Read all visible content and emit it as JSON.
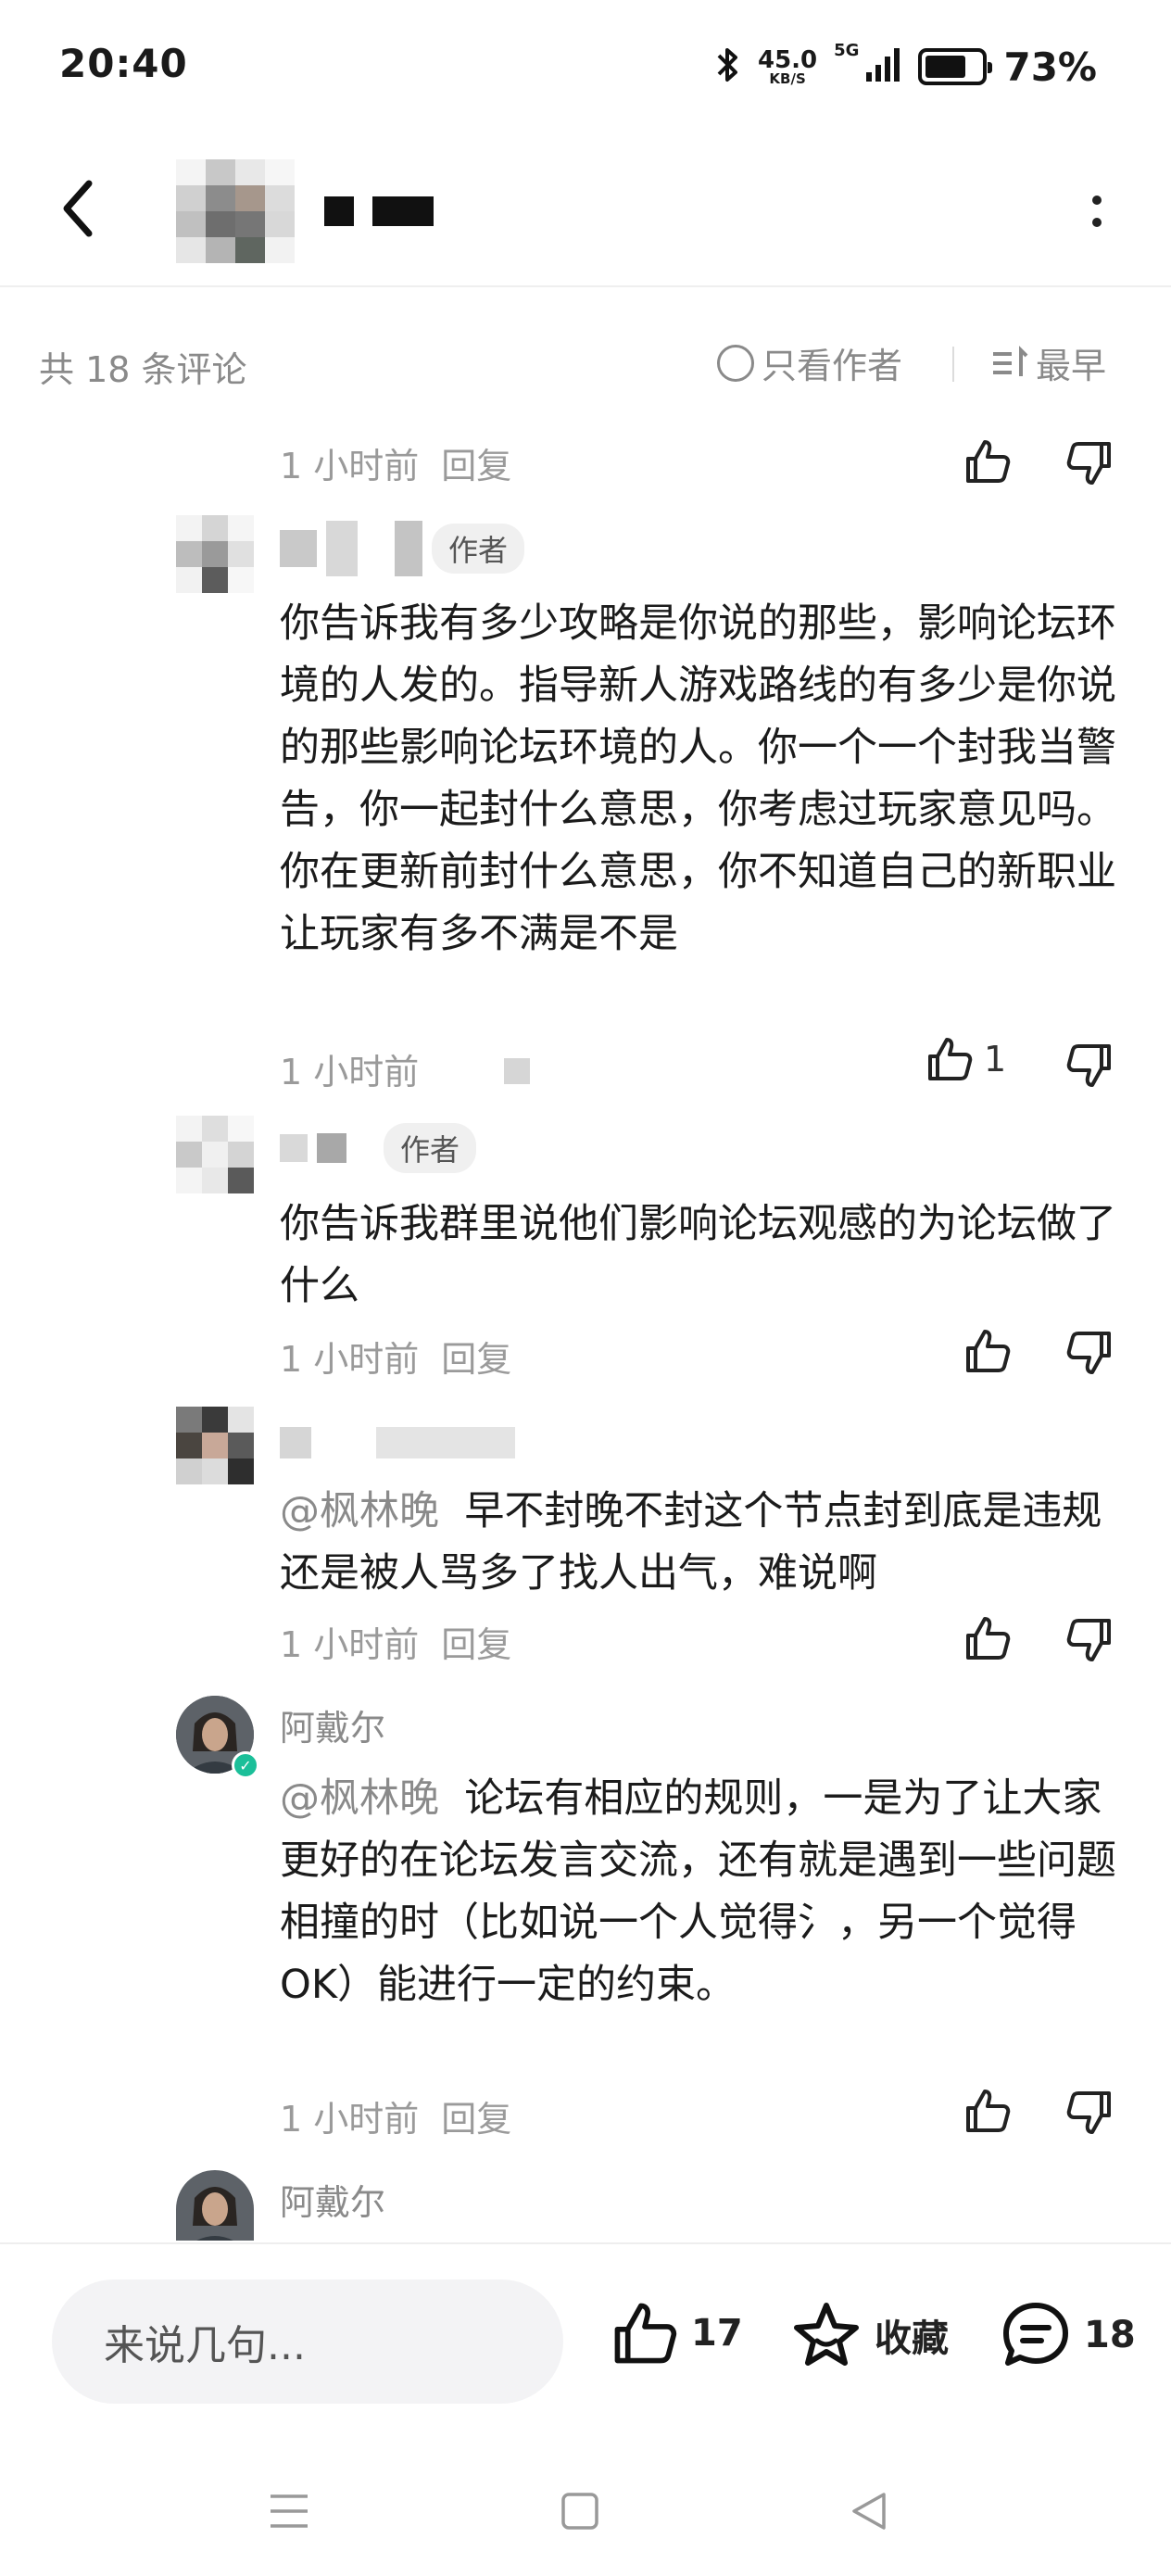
{
  "status_bar": {
    "time": "20:40",
    "net_speed": "45.0",
    "net_speed_unit": "KB/S",
    "network": "5G",
    "battery": "73%",
    "battery_level": 0.73,
    "icons": [
      "bluetooth-icon",
      "signal-icon",
      "battery-icon"
    ]
  },
  "header": {
    "title": "",
    "back_icon": "chevron-left-icon",
    "more_icon": "more-vertical-icon"
  },
  "comments_toolbar": {
    "count_label": "共 18 条评论",
    "only_author_label": "只看作者",
    "sort_label": "最早"
  },
  "comments": [
    {
      "time": "1 小时前",
      "reply_label": "回复"
    },
    {
      "author_tag": "作者",
      "text": "你告诉我有多少攻略是你说的那些，影响论坛环境的人发的。指导新人游戏路线的有多少是你说的那些影响论坛环境的人。你一个一个封我当警告，你一起封什么意思，你考虑过玩家意见吗。你在更新前封什么意思，你不知道自己的新职业让玩家有多不满是不是",
      "time": "1 小时前",
      "like_count": "1"
    },
    {
      "author_tag": "作者",
      "text": "你告诉我群里说他们影响论坛观感的为论坛做了什么",
      "time": "1 小时前",
      "reply_label": "回复"
    },
    {
      "mention": "@枫林晚",
      "text": "早不封晚不封这个节点封到底是违规还是被人骂多了找人出气，难说啊",
      "time": "1 小时前",
      "reply_label": "回复"
    },
    {
      "username": "阿戴尔",
      "mention": "@枫林晚",
      "text": "论坛有相应的规则，一是为了让大家更好的在论坛发言交流，还有就是遇到一些问题相撞的时（比如说一个人觉得氵，另一个觉得OK）能进行一定的约束。",
      "time": "1 小时前",
      "reply_label": "回复"
    },
    {
      "username": "阿戴尔"
    }
  ],
  "bottom_bar": {
    "input_placeholder": "来说几句...",
    "like_count": "17",
    "favorite_label": "收藏",
    "comment_count": "18"
  },
  "colors": {
    "text_primary": "#1b1b1b",
    "text_secondary": "#8a8a8a",
    "verified_badge": "#1bbf99",
    "input_bg": "#f3f3f5"
  }
}
